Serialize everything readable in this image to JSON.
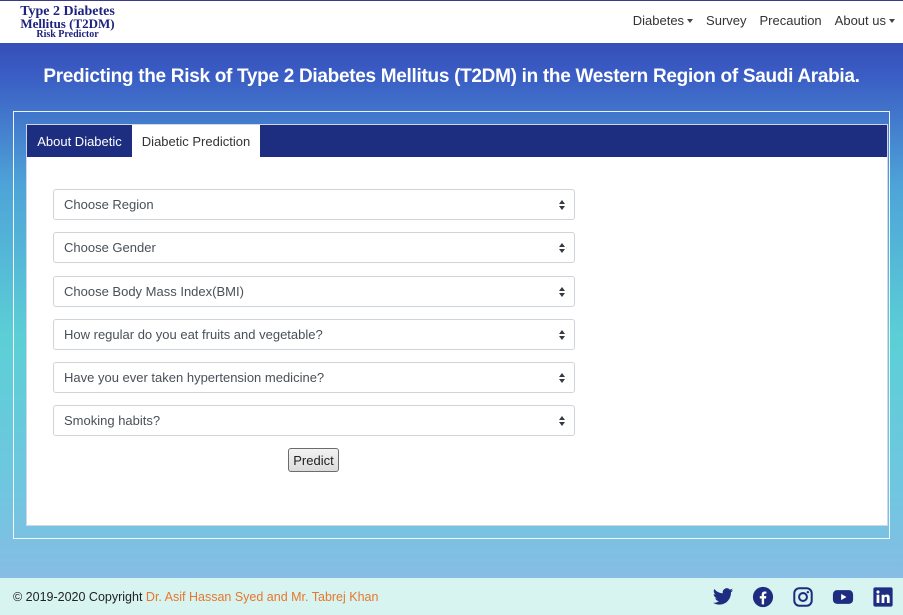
{
  "brand": {
    "line1": "Type 2 Diabetes",
    "line2": "Mellitus (T2DM)",
    "line3": "Risk Predictor"
  },
  "nav": {
    "diabetes": "Diabetes",
    "survey": "Survey",
    "precaution": "Precaution",
    "about": "About us"
  },
  "hero": {
    "title": "Predicting the Risk of Type 2 Diabetes Mellitus (T2DM) in the Western Region of Saudi Arabia."
  },
  "tabs": {
    "about": "About Diabetic",
    "prediction": "Diabetic Prediction"
  },
  "form": {
    "region": "Choose Region",
    "gender": "Choose Gender",
    "bmi": "Choose Body Mass Index(BMI)",
    "fruits": "How regular do you eat fruits and vegetable?",
    "hypertension": "Have you ever taken hypertension medicine?",
    "smoking": "Smoking habits?",
    "predict": "Predict"
  },
  "footer": {
    "copyright": "© 2019-2020 Copyright",
    "authors": "Dr. Asif Hassan Syed and Mr. Tabrej Khan"
  },
  "colors": {
    "navy": "#1d2d80",
    "author_orange": "#e8762b",
    "footer_bg": "#d7f4f1"
  },
  "social_icons": [
    "twitter-icon",
    "facebook-icon",
    "instagram-icon",
    "youtube-icon",
    "linkedin-icon"
  ]
}
